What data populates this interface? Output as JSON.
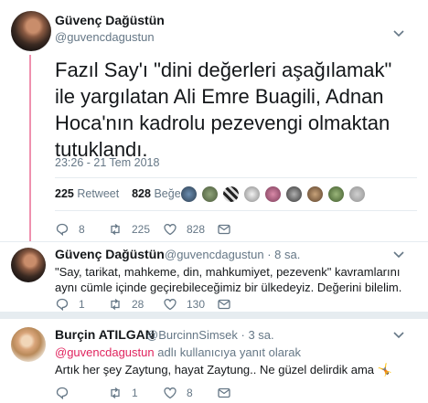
{
  "main_tweet": {
    "name": "Güvenç Dağüstün",
    "handle": "@guvencdagustun",
    "text": "Fazıl Say'ı \"dini değerleri aşağılamak\" ile yargılatan Ali Emre Buagili, Adnan Hoca'nın kadrolu pezevengi olmaktan tutuklandı.",
    "timestamp": "23:26 - 21 Tem 2018",
    "retweets_count": "225",
    "retweets_label": "Retweet",
    "likes_count": "828",
    "likes_label": "Beğeni",
    "actions": {
      "reply": "8",
      "retweet": "225",
      "like": "828"
    }
  },
  "reply1": {
    "name": "Güvenç Dağüstün",
    "handle": "@guvencdagustun · 8 sa.",
    "text": "\"Say, tarikat, mahkeme, din, mahkumiyet, pezevenk\" kavramlarını aynı cümle içinde geçirebileceğimiz bir ülkedeyiz. Değerini bilelim.",
    "actions": {
      "reply": "1",
      "retweet": "28",
      "like": "130"
    }
  },
  "reply2": {
    "name": "Burçin ATILGAN",
    "handle": "@BurcinnSimsek · 3 sa.",
    "reply_to_mention": "@guvencdagustun",
    "reply_to_suffix": "adlı kullanıcıya yanıt olarak",
    "text": "Artık her şey Zaytung, hayat Zaytung.. Ne güzel delirdik ama",
    "emoji": "🤸",
    "actions": {
      "reply": "",
      "retweet": "1",
      "like": "8"
    }
  },
  "colors": {
    "accent": "#e0245e",
    "muted": "#657786",
    "text": "#14171a"
  }
}
